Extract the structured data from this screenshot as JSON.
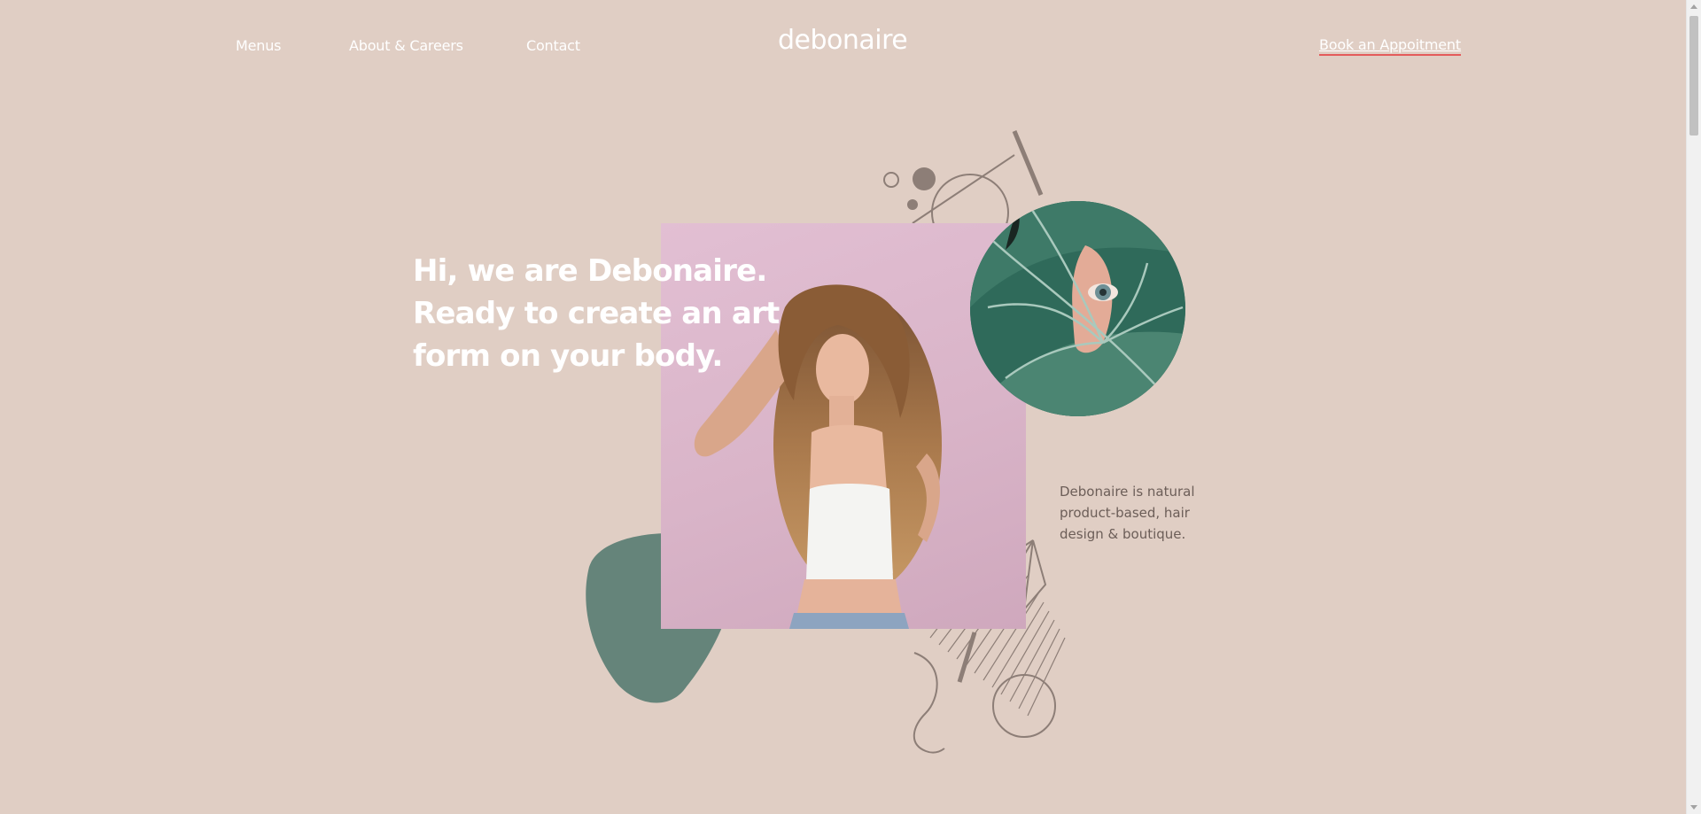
{
  "nav": {
    "menus": "Menus",
    "about": "About & Careers",
    "contact": "Contact",
    "logo": "debonaire",
    "book": "Book an Appoitment"
  },
  "hero": {
    "title_lines": [
      "Hi, we are Debonaire.",
      "Ready to create an art",
      "form on your body."
    ],
    "tagline_lines": [
      "Debonaire is natural",
      "product-based, hair",
      "design & boutique."
    ]
  },
  "colors": {
    "background": "#e0cec4",
    "accent_underline": "#e45b5b",
    "blob": "#65847a",
    "deco_line": "#8d7e77"
  },
  "images": {
    "main_photo": "woman-with-curly-hair-photo",
    "circle_photo": "eye-behind-leaf-photo"
  }
}
